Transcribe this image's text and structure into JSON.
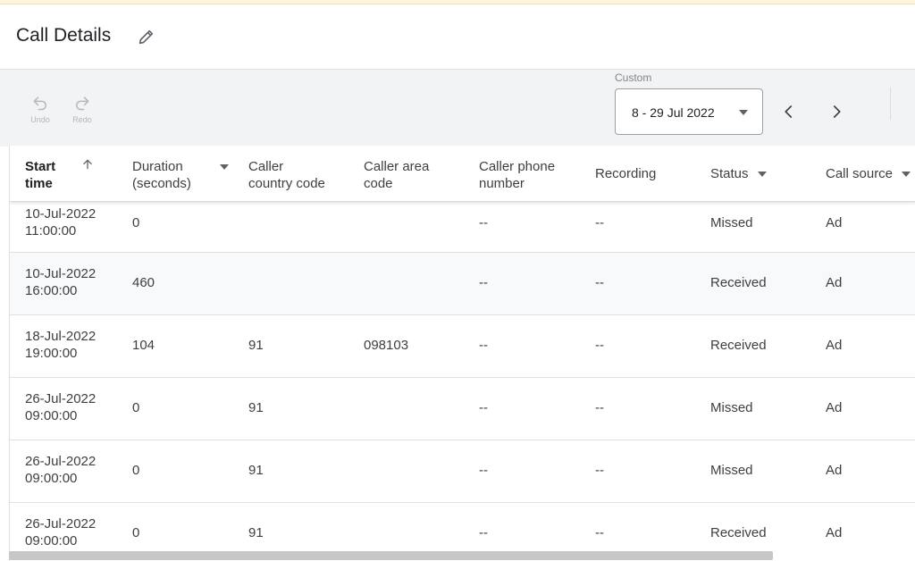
{
  "header": {
    "title": "Call Details"
  },
  "toolbar": {
    "undo_label": "Undo",
    "redo_label": "Redo",
    "range_label": "Custom",
    "range_value": "8 - 29 Jul 2022"
  },
  "table": {
    "columns": [
      {
        "line1": "Start",
        "line2": "time"
      },
      {
        "line1": "Duration",
        "line2": "(seconds)"
      },
      {
        "line1": "Caller",
        "line2": "country code"
      },
      {
        "line1": "Caller area",
        "line2": "code"
      },
      {
        "line1": "Caller phone",
        "line2": "number"
      },
      {
        "line1": "Recording",
        "line2": ""
      },
      {
        "line1": "Status",
        "line2": ""
      },
      {
        "line1": "Call source",
        "line2": ""
      }
    ],
    "rows": [
      {
        "date": "10-Jul-2022",
        "time": "11:00:00",
        "duration": "0",
        "country": "",
        "area": "",
        "phone": "--",
        "recording": "--",
        "status": "Missed",
        "source": "Ad"
      },
      {
        "date": "10-Jul-2022",
        "time": "16:00:00",
        "duration": "460",
        "country": "",
        "area": "",
        "phone": "--",
        "recording": "--",
        "status": "Received",
        "source": "Ad"
      },
      {
        "date": "18-Jul-2022",
        "time": "19:00:00",
        "duration": "104",
        "country": "91",
        "area": "098103",
        "phone": "--",
        "recording": "--",
        "status": "Received",
        "source": "Ad"
      },
      {
        "date": "26-Jul-2022",
        "time": "09:00:00",
        "duration": "0",
        "country": "91",
        "area": "",
        "phone": "--",
        "recording": "--",
        "status": "Missed",
        "source": "Ad"
      },
      {
        "date": "26-Jul-2022",
        "time": "09:00:00",
        "duration": "0",
        "country": "91",
        "area": "",
        "phone": "--",
        "recording": "--",
        "status": "Missed",
        "source": "Ad"
      },
      {
        "date": "26-Jul-2022",
        "time": "09:00:00",
        "duration": "0",
        "country": "91",
        "area": "",
        "phone": "--",
        "recording": "--",
        "status": "Received",
        "source": "Ad"
      }
    ]
  }
}
